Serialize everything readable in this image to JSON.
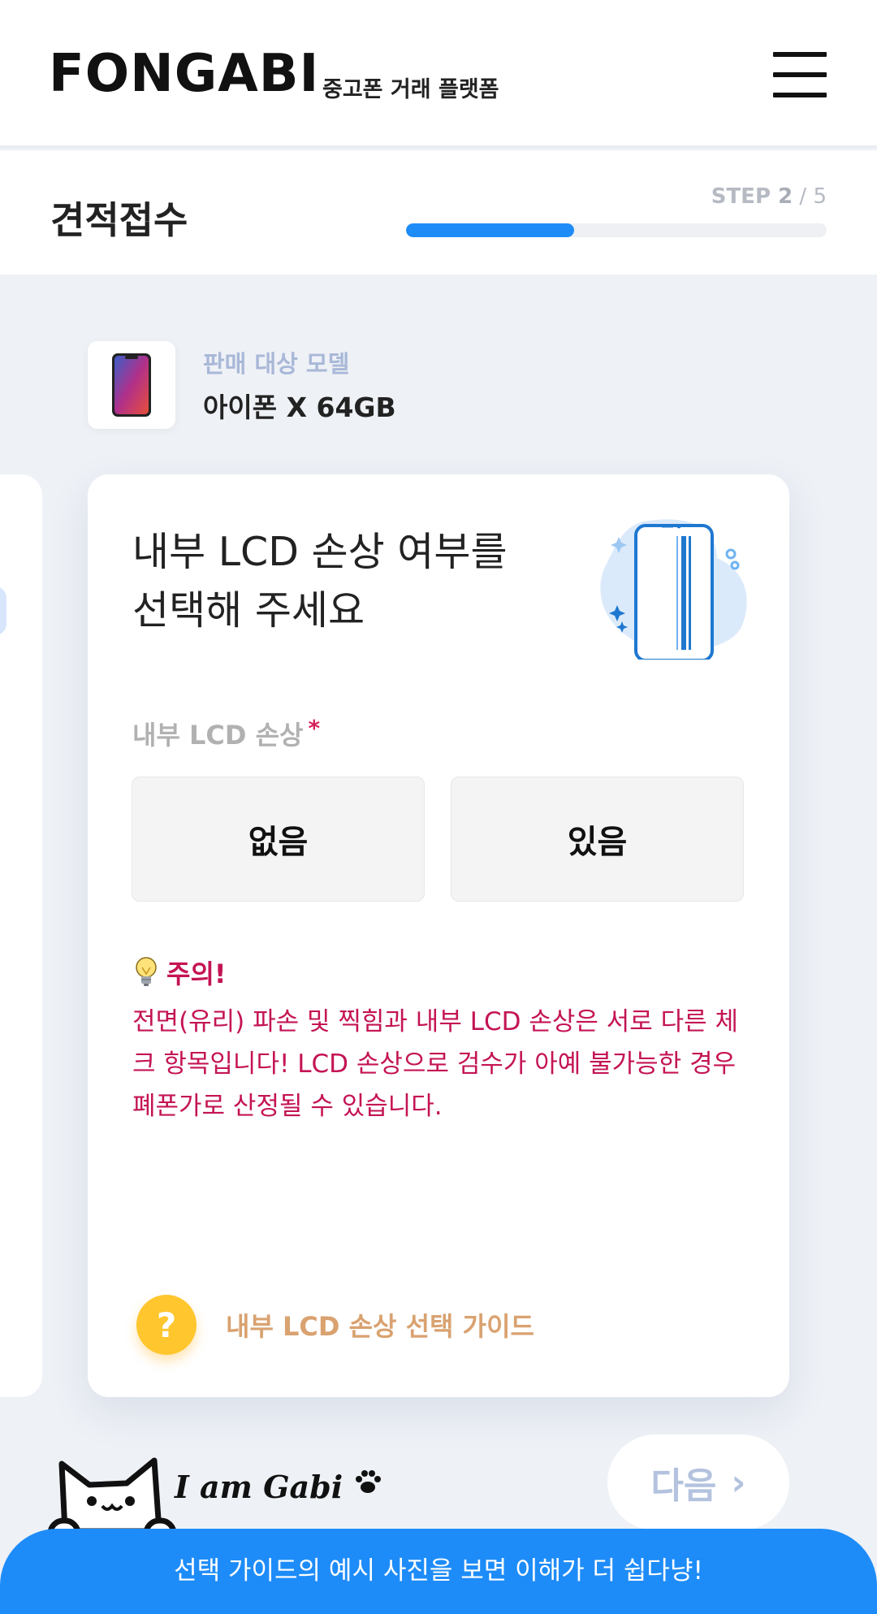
{
  "header": {
    "logo": "FONGABI",
    "tagline": "중고폰 거래 플랫폼",
    "menu_icon": "hamburger-menu-icon"
  },
  "stepbar": {
    "title": "견적접수",
    "step_prefix": "STEP ",
    "step_current": "2",
    "step_sep": " / ",
    "step_total": "5",
    "progress_fraction": 0.4,
    "progress_color": "#1e8cf8"
  },
  "model": {
    "label": "판매 대상 모델",
    "name": "아이폰 X 64GB"
  },
  "card": {
    "title_line1": "내부 LCD 손상 여부를",
    "title_line2": "선택해 주세요",
    "field_label": "내부 LCD 손상",
    "required_mark": "*",
    "options": [
      "없음",
      "있음"
    ],
    "warning_title": "주의!",
    "warning_text": "전면(유리) 파손 및 찍힘과 내부 LCD 손상은 서로 다른 체크 항목입니다! LCD 손상으로 검수가 아예 불가능한 경우 폐폰가로 산정될 수 있습니다.",
    "guide_icon_text": "?",
    "guide_label": "내부 LCD 손상 선택 가이드"
  },
  "footer": {
    "next_label": "다음",
    "next_chevron": "›",
    "mascot_name": "I am Gabi",
    "bubble_text": "선택 가이드의 예시 사진을 보면 이해가 더 쉽다냥!"
  },
  "colors": {
    "accent": "#1e8cf8",
    "warning": "#c41454",
    "guide": "#d9a270",
    "guide_icon": "#ffc62e"
  }
}
